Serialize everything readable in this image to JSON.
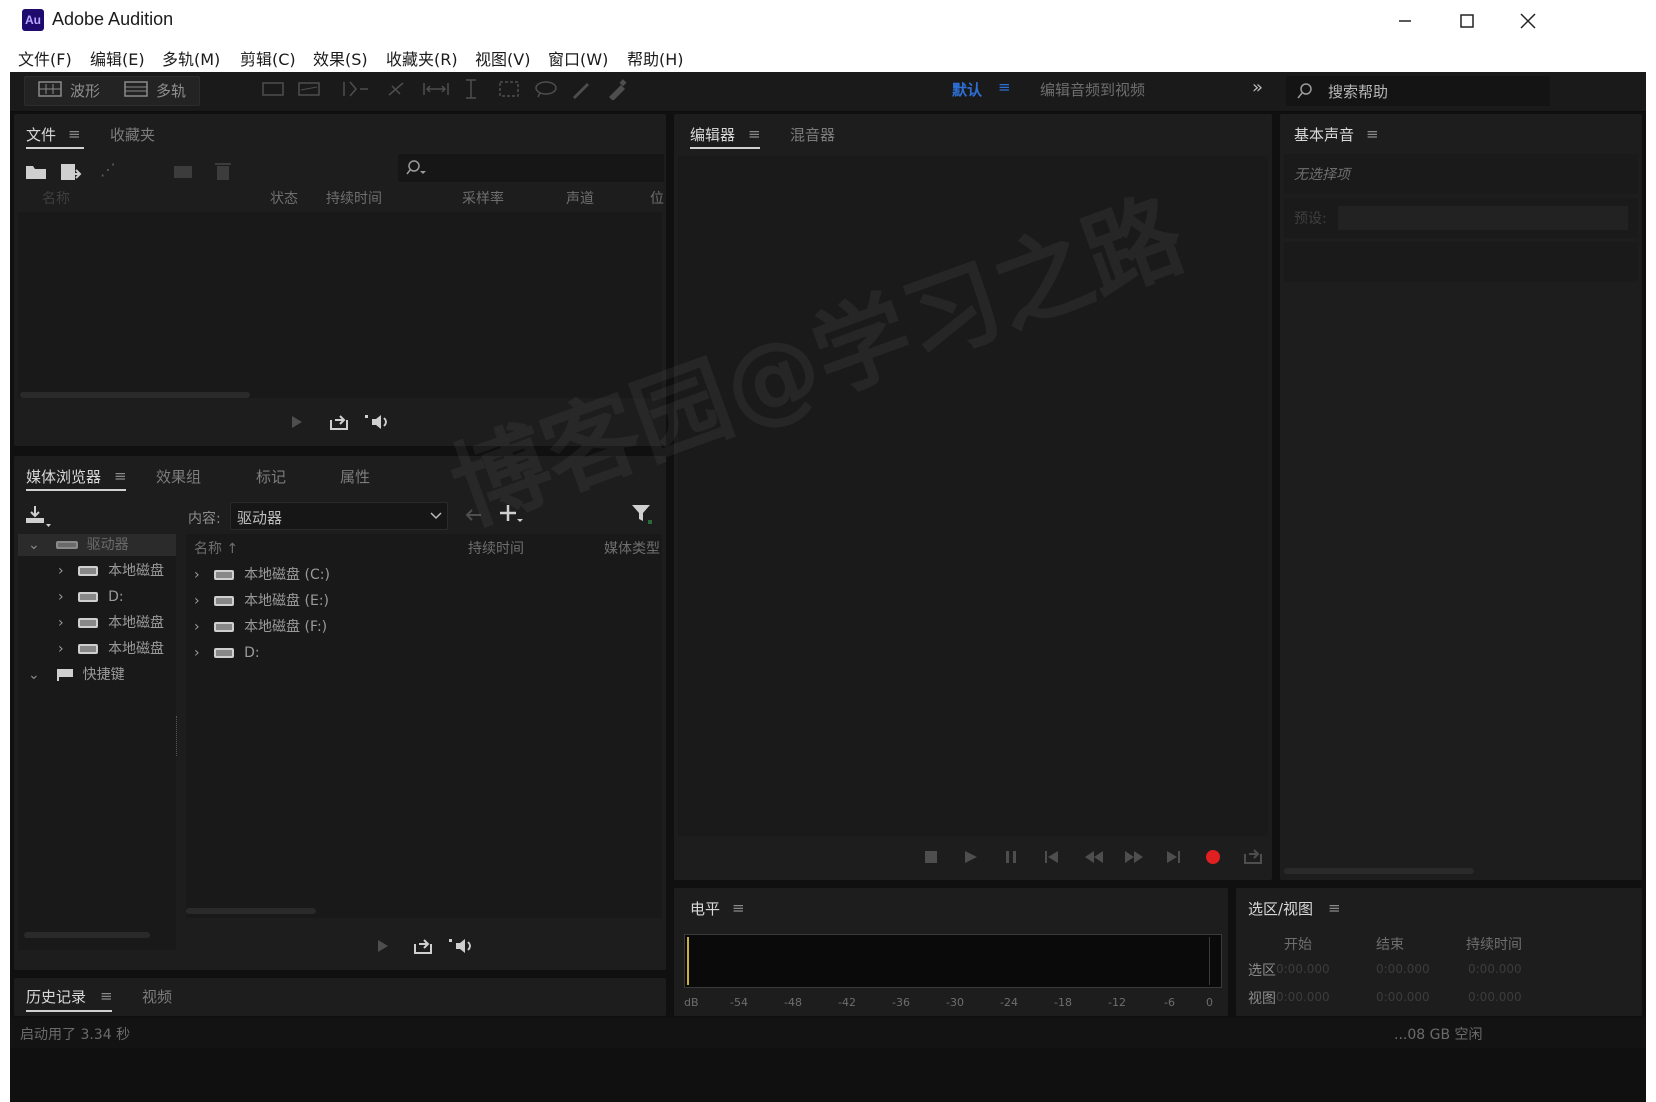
{
  "window": {
    "app_icon": "Au",
    "title": "Adobe Audition",
    "controls": [
      "minimize-icon",
      "maximize-icon",
      "close-icon"
    ]
  },
  "menu": [
    "文件(F)",
    "编辑(E)",
    "多轨(M)",
    "剪辑(C)",
    "效果(S)",
    "收藏夹(R)",
    "视图(V)",
    "窗口(W)",
    "帮助(H)"
  ],
  "toolbar": {
    "waveform_label": "波形",
    "multitrack_label": "多轨",
    "workspace_label": "默认",
    "workspace_menu": "编辑音频到视频",
    "search_placeholder": "搜索帮助"
  },
  "files_panel": {
    "tabs": [
      "文件",
      "收藏夹"
    ],
    "columns": [
      "名称",
      "状态",
      "持续时间",
      "采样率",
      "声道",
      "位"
    ]
  },
  "media_browser": {
    "tabs": [
      "媒体浏览器",
      "效果组",
      "标记",
      "属性"
    ],
    "content_label": "内容:",
    "content_value": "驱动器",
    "tree": {
      "root": "驱动器",
      "items": [
        "本地磁盘",
        "D:",
        "本地磁盘",
        "本地磁盘"
      ],
      "shortcuts": "快捷键"
    },
    "columns": [
      "名称 ↑",
      "持续时间",
      "媒体类型"
    ],
    "rows": [
      "本地磁盘 (C:)",
      "本地磁盘 (E:)",
      "本地磁盘 (F:)",
      "D:"
    ]
  },
  "history_panel": {
    "tabs": [
      "历史记录",
      "视频"
    ]
  },
  "editor_panel": {
    "tabs": [
      "编辑器",
      "混音器"
    ]
  },
  "essential_sound": {
    "title": "基本声音",
    "no_selection": "无选择项",
    "preset_label": "预设:"
  },
  "levels_panel": {
    "title": "电平",
    "scale": [
      "dB",
      "-54",
      "-48",
      "-42",
      "-36",
      "-30",
      "-24",
      "-18",
      "-12",
      "-6",
      "0"
    ]
  },
  "selection_view": {
    "title": "选区/视图",
    "columns": [
      "开始",
      "结束",
      "持续时间"
    ],
    "rows": [
      {
        "label": "选区",
        "values": [
          "0:00.000",
          "0:00.000",
          "0:00.000"
        ]
      },
      {
        "label": "视图",
        "values": [
          "0:00.000",
          "0:00.000",
          "0:00.000"
        ]
      }
    ]
  },
  "status_bar": {
    "left": "启动用了 3.34 秒",
    "right": "...08 GB 空闲"
  },
  "watermark": "博客园@学习之路",
  "colors": {
    "background": "#101010",
    "panel": "#1d1d1d",
    "accent_blue": "#2d6fd6",
    "record_red": "#e02020"
  }
}
